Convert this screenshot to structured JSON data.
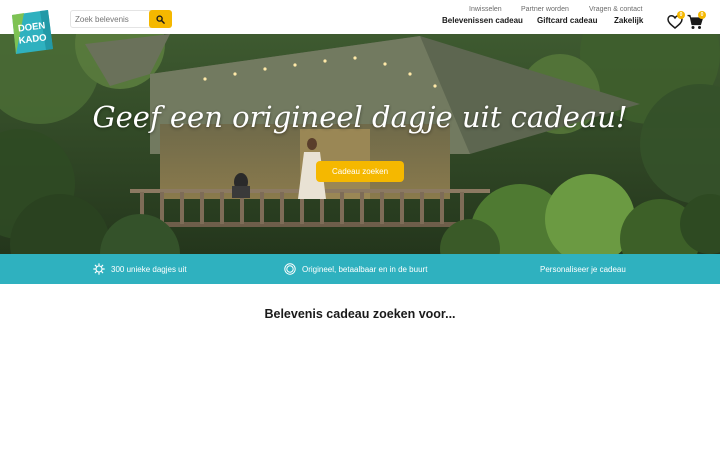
{
  "brand": {
    "logo_line1": "DOEN",
    "logo_line2": "KADO",
    "accent": "#f5b800",
    "teal": "#2fb1bf"
  },
  "search": {
    "placeholder": "Zoek belevenis",
    "icon": "search-icon"
  },
  "nav": {
    "top": [
      "Inwisselen",
      "Partner worden",
      "Vragen & contact"
    ],
    "main": [
      "Belevenissen cadeau",
      "Giftcard cadeau",
      "Zakelijk"
    ]
  },
  "header_icons": {
    "wishlist": {
      "icon": "heart-icon",
      "count": "0"
    },
    "cart": {
      "icon": "cart-icon",
      "count": "0"
    }
  },
  "hero": {
    "title": "Geef een origineel dagje uit cadeau!",
    "cta_label": "Cadeau zoeken"
  },
  "usps": [
    {
      "icon": "gear-badge-icon",
      "label": "300 unieke dagjes uit"
    },
    {
      "icon": "seal-icon",
      "label": "Origineel, betaalbaar en in de buurt"
    },
    {
      "icon": "",
      "label": "Personaliseer je cadeau"
    }
  ],
  "section": {
    "title": "Belevenis cadeau zoeken voor..."
  }
}
